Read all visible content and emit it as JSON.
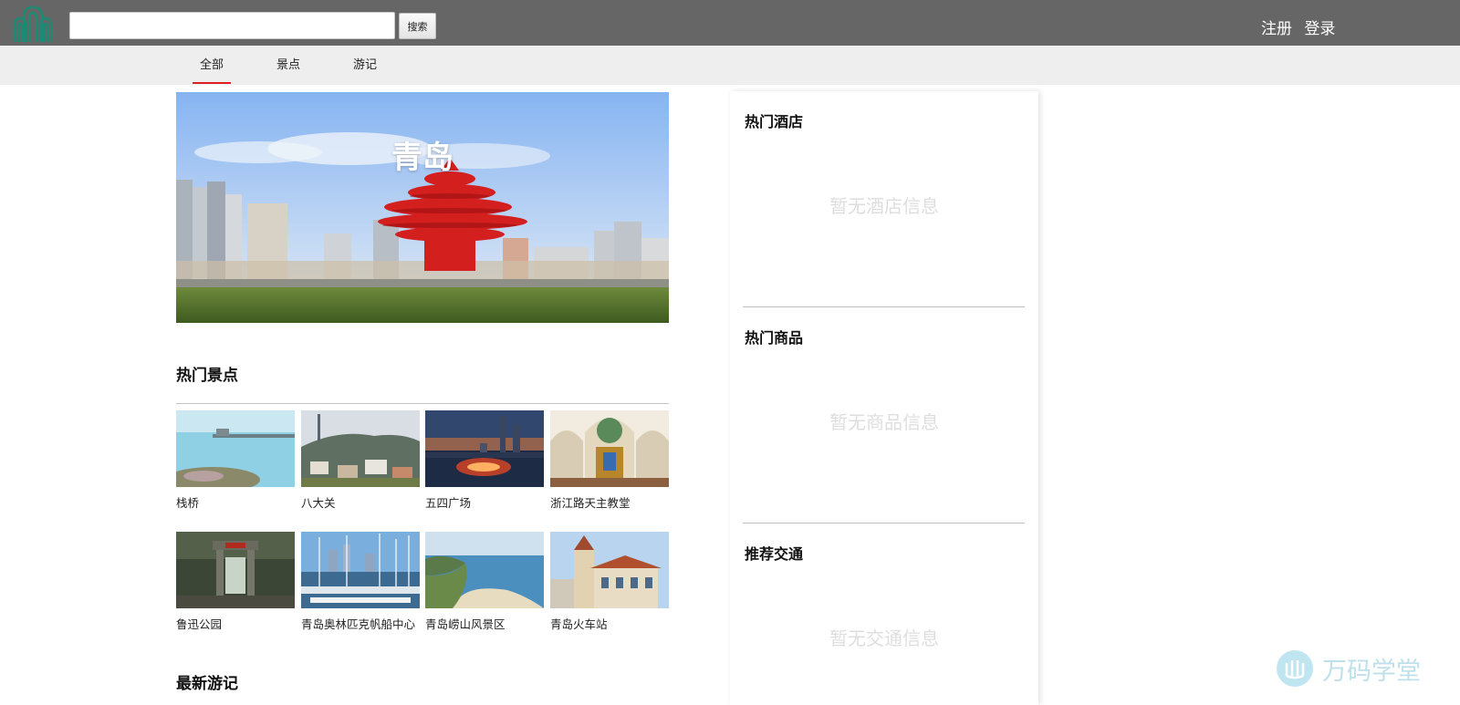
{
  "header": {
    "logo_icon": "building-logo-icon",
    "search": {
      "value": "",
      "placeholder": ""
    },
    "search_button_label": "搜索",
    "register_label": "注册",
    "login_label": "登录"
  },
  "nav": {
    "tabs": [
      {
        "label": "全部",
        "active": true
      },
      {
        "label": "景点",
        "active": false
      },
      {
        "label": "游记",
        "active": false
      }
    ]
  },
  "hero": {
    "title": "青岛"
  },
  "attractions": {
    "title": "热门景点",
    "items": [
      {
        "name": "栈桥"
      },
      {
        "name": "八大关"
      },
      {
        "name": "五四广场"
      },
      {
        "name": "浙江路天主教堂"
      },
      {
        "name": "鲁迅公园"
      },
      {
        "name": "青岛奥林匹克帆船中心"
      },
      {
        "name": "青岛崂山风景区"
      },
      {
        "name": "青岛火车站"
      }
    ]
  },
  "travelogues": {
    "title": "最新游记"
  },
  "sidebar": {
    "hotels": {
      "title": "热门酒店",
      "empty": "暂无酒店信息"
    },
    "goods": {
      "title": "热门商品",
      "empty": "暂无商品信息"
    },
    "transport": {
      "title": "推荐交通",
      "empty": "暂无交通信息"
    }
  },
  "watermark": {
    "text": "万码学堂",
    "icon": "wanma-logo-icon"
  },
  "colors": {
    "header_bg": "#666666",
    "nav_bg": "#eeeeee",
    "tab_active_underline": "#e02020",
    "empty_text": "#dedede"
  }
}
